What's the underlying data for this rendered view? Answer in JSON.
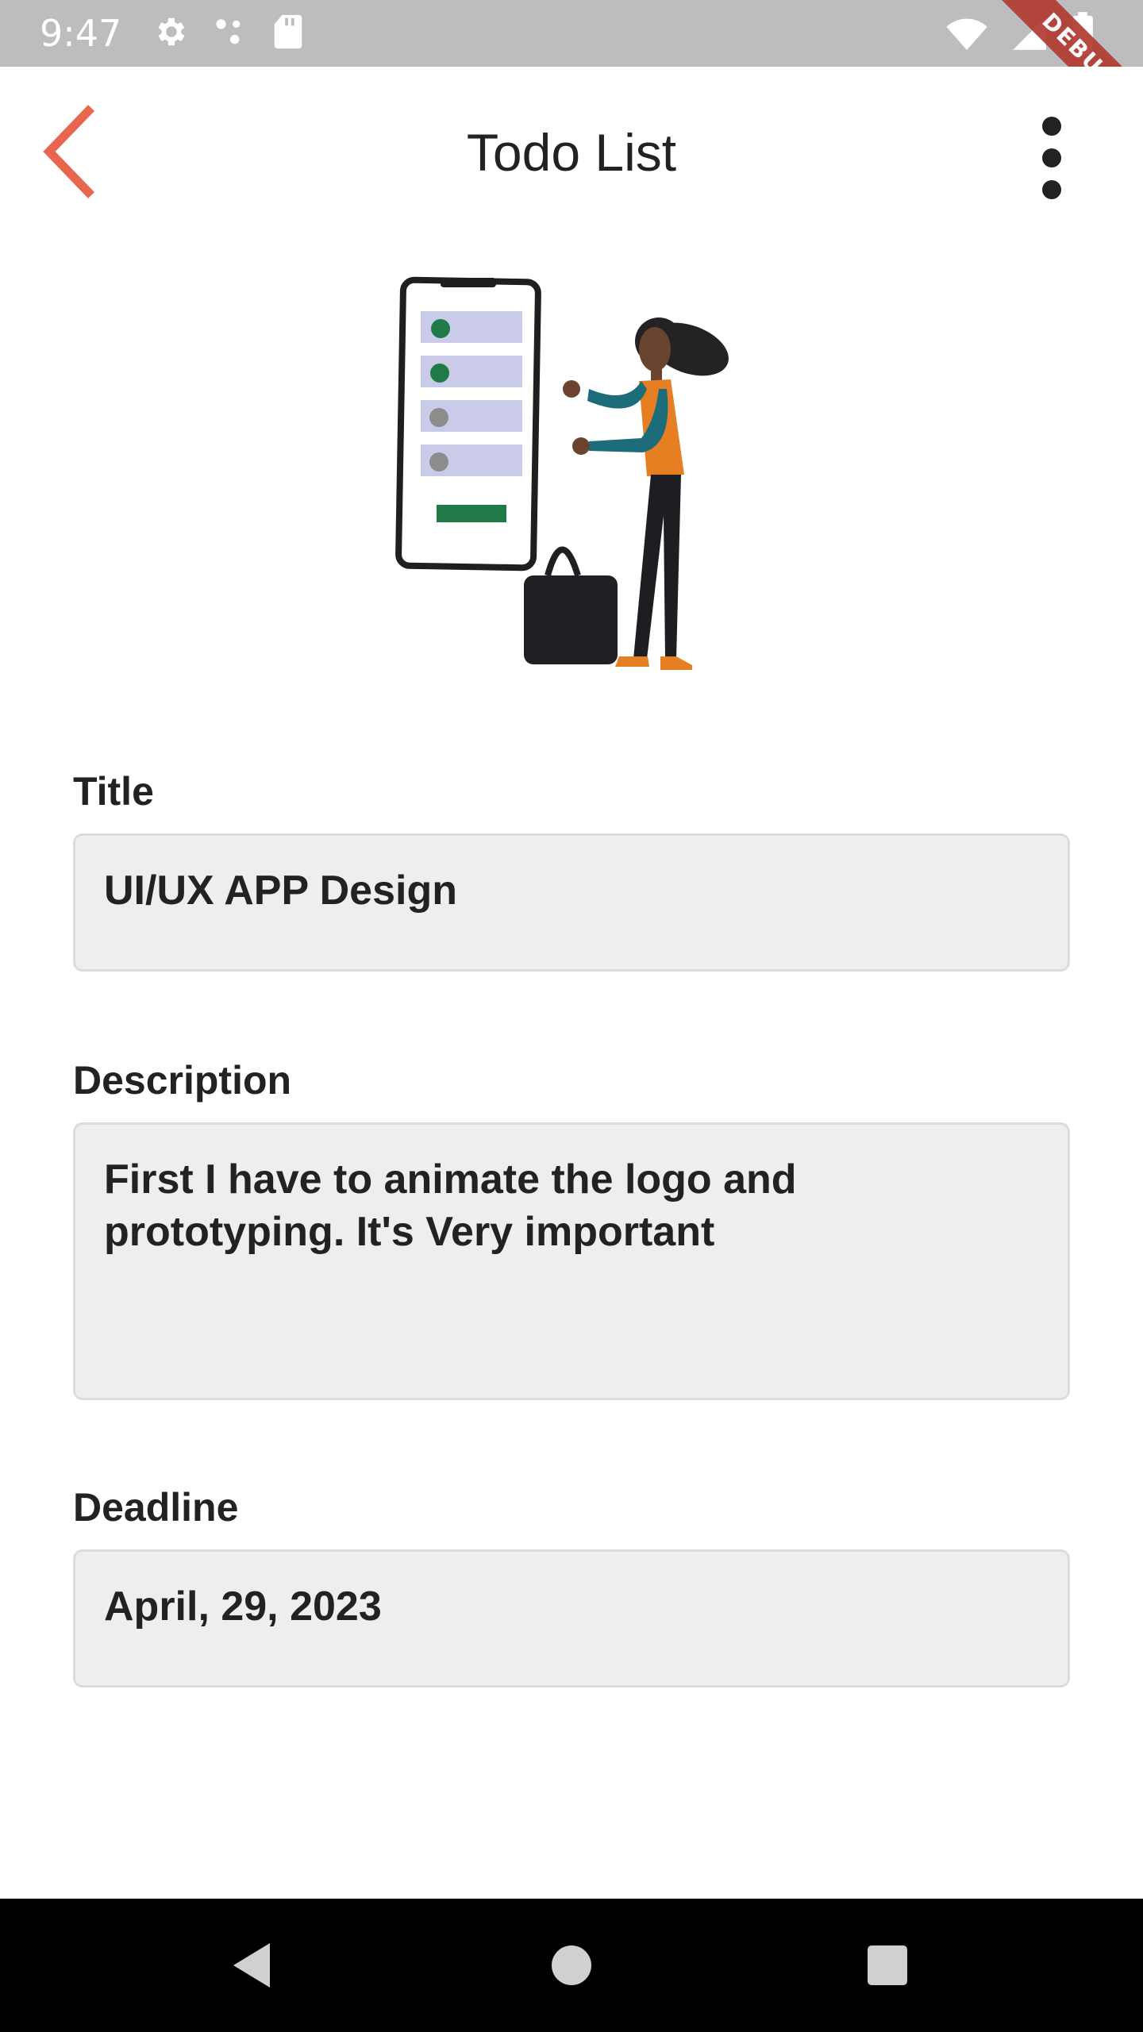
{
  "status_bar": {
    "time": "9:47",
    "left_icons": [
      "settings-icon",
      "dots-icon",
      "sd-card-icon"
    ],
    "right_icons": [
      "wifi-icon",
      "signal-icon",
      "battery-icon"
    ],
    "debug_label": "DEBUG"
  },
  "app_bar": {
    "title": "Todo List",
    "back_icon": "chevron-left-icon",
    "menu_icon": "more-vertical-icon",
    "accent_color": "#e8654f"
  },
  "illustration": {
    "subject": "woman-with-phone-checklist"
  },
  "form": {
    "title_label": "Title",
    "title_value": "UI/UX APP Design",
    "description_label": "Description",
    "description_value": "First I have to animate the logo and prototyping. It's Very important",
    "deadline_label": "Deadline",
    "deadline_value": "April, 29, 2023"
  },
  "nav_bar": {
    "back_icon": "triangle-back-icon",
    "home_icon": "circle-home-icon",
    "recents_icon": "square-recents-icon"
  }
}
